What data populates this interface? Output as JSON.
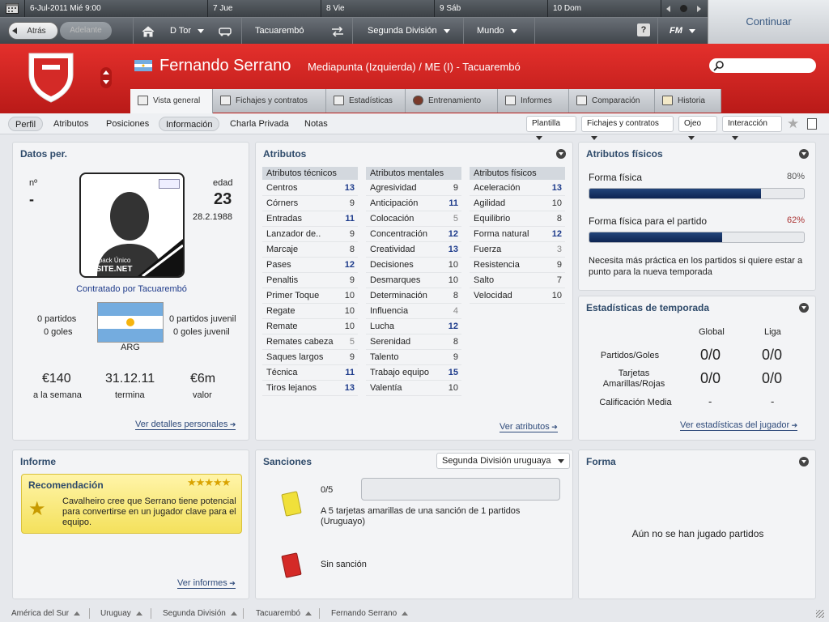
{
  "topbar": {
    "date": "6-Jul-2011 Mié 9:00",
    "days": [
      "7 Jue",
      "8 Vie",
      "9 Sáb",
      "10 Dom"
    ],
    "continue_label": "Continuar"
  },
  "nav": {
    "back": "Atrás",
    "forward": "Adelante",
    "manager": "D Tor",
    "team": "Tacuarembó",
    "division": "Segunda División",
    "world": "Mundo",
    "help": "?",
    "fm": "FM"
  },
  "player": {
    "name": "Fernando Serrano",
    "subtitle": "Mediapunta (Izquierda) / ME (I) - Tacuarembó"
  },
  "tabs": [
    {
      "label": "Vista general",
      "active": true
    },
    {
      "label": "Fichajes y contratos"
    },
    {
      "label": "Estadísticas"
    },
    {
      "label": "Entrenamiento"
    },
    {
      "label": "Informes"
    },
    {
      "label": "Comparación"
    },
    {
      "label": "Historia"
    }
  ],
  "subnav": {
    "items": [
      "Perfil",
      "Atributos",
      "Posiciones",
      "Información",
      "Charla Privada",
      "Notas"
    ],
    "dropdowns": [
      "Plantilla",
      "Fichajes y contratos",
      "Ojeo",
      "Interacción"
    ]
  },
  "datos": {
    "title": "Datos per.",
    "number_label": "nº",
    "number_value": "-",
    "age_label": "edad",
    "age_value": "23",
    "dob": "28.2.1988",
    "facepack": "Facepack Único",
    "fmsite": "FMSITE.NET",
    "contracted": "Contratado por Tacuarembó",
    "matches": "0 partidos",
    "goals": "0 goles",
    "country": "ARG",
    "youth_matches": "0 partidos juvenil",
    "youth_goals": "0 goles juvenil",
    "wage": "€140",
    "wage_label": "a la semana",
    "expiry": "31.12.11",
    "expiry_label": "termina",
    "value": "€6m",
    "value_label": "valor",
    "link": "Ver detalles personales"
  },
  "atributos": {
    "title": "Atributos",
    "tecnicos_title": "Atributos técnicos",
    "mentales_title": "Atributos mentales",
    "fisicos_title": "Atributos físicos",
    "tecnicos": [
      {
        "name": "Centros",
        "value": "13"
      },
      {
        "name": "Córners",
        "value": "9"
      },
      {
        "name": "Entradas",
        "value": "11"
      },
      {
        "name": "Lanzador de..",
        "value": "9"
      },
      {
        "name": "Marcaje",
        "value": "8"
      },
      {
        "name": "Pases",
        "value": "12"
      },
      {
        "name": "Penaltis",
        "value": "9"
      },
      {
        "name": "Primer Toque",
        "value": "10"
      },
      {
        "name": "Regate",
        "value": "10"
      },
      {
        "name": "Remate",
        "value": "10"
      },
      {
        "name": "Remates cabeza",
        "value": "5"
      },
      {
        "name": "Saques largos",
        "value": "9"
      },
      {
        "name": "Técnica",
        "value": "11"
      },
      {
        "name": "Tiros lejanos",
        "value": "13"
      }
    ],
    "mentales": [
      {
        "name": "Agresividad",
        "value": "9"
      },
      {
        "name": "Anticipación",
        "value": "11"
      },
      {
        "name": "Colocación",
        "value": "5"
      },
      {
        "name": "Concentración",
        "value": "12"
      },
      {
        "name": "Creatividad",
        "value": "13"
      },
      {
        "name": "Decisiones",
        "value": "10"
      },
      {
        "name": "Desmarques",
        "value": "10"
      },
      {
        "name": "Determinación",
        "value": "8"
      },
      {
        "name": "Influencia",
        "value": "4"
      },
      {
        "name": "Lucha",
        "value": "12"
      },
      {
        "name": "Serenidad",
        "value": "8"
      },
      {
        "name": "Talento",
        "value": "9"
      },
      {
        "name": "Trabajo equipo",
        "value": "15"
      },
      {
        "name": "Valentía",
        "value": "10"
      }
    ],
    "fisicos": [
      {
        "name": "Aceleración",
        "value": "13"
      },
      {
        "name": "Agilidad",
        "value": "10"
      },
      {
        "name": "Equilibrio",
        "value": "8"
      },
      {
        "name": "Forma natural",
        "value": "12"
      },
      {
        "name": "Fuerza",
        "value": "3"
      },
      {
        "name": "Resistencia",
        "value": "9"
      },
      {
        "name": "Salto",
        "value": "7"
      },
      {
        "name": "Velocidad",
        "value": "10"
      }
    ],
    "link": "Ver atributos"
  },
  "fisicos_panel": {
    "title": "Atributos físicos",
    "forma_label": "Forma física",
    "forma_pct": "80%",
    "forma_value": 0.8,
    "partido_label": "Forma física para el partido",
    "partido_pct": "62%",
    "partido_value": 0.62,
    "note": "Necesita más práctica en los partidos si quiere estar a punto para la nueva temporada"
  },
  "temporada": {
    "title": "Estadísticas de temporada",
    "col_global": "Global",
    "col_liga": "Liga",
    "rows": [
      {
        "label": "Partidos/Goles",
        "global": "0/0",
        "liga": "0/0"
      },
      {
        "label": "Tarjetas Amarillas/Rojas",
        "global": "0/0",
        "liga": "0/0"
      },
      {
        "label": "Calificación Media",
        "global": "-",
        "liga": "-"
      }
    ],
    "link": "Ver estadísticas del jugador"
  },
  "informe": {
    "title": "Informe",
    "rec_title": "Recomendación",
    "stars": "★★★★★",
    "rec_text": "Cavalheiro cree que Serrano tiene potencial para convertirse en un jugador clave para el equipo.",
    "link": "Ver informes"
  },
  "sanciones": {
    "title": "Sanciones",
    "dropdown": "Segunda División uruguaya",
    "count": "0/5",
    "yellow_text": "A 5 tarjetas amarillas de una sanción de 1 partidos (Uruguayo)",
    "red_text": "Sin sanción"
  },
  "forma": {
    "title": "Forma",
    "empty": "Aún no se han jugado partidos"
  },
  "footer": [
    "América del Sur",
    "Uruguay",
    "Segunda División",
    "Tacuarembó",
    "Fernando Serrano"
  ],
  "colors": {
    "header_red": "#d42a27",
    "bar_fill": "#0d2452",
    "link": "#2e4a7a",
    "value_hi": "#1d3b8b",
    "pct_red": "#a33"
  }
}
